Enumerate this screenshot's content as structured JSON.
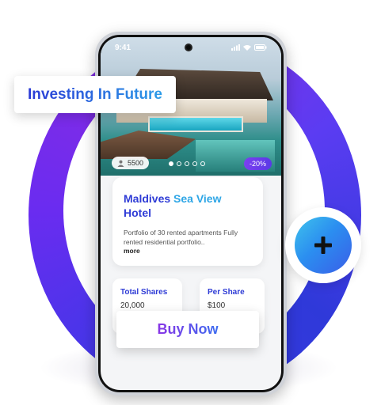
{
  "status_bar": {
    "time": "9:41"
  },
  "callouts": {
    "headline": "Investing In Future",
    "buy_now": "Buy Now"
  },
  "property": {
    "owners_count": "5500",
    "discount": "-20%",
    "title_part1": "Maldives",
    "title_part2": "Sea View",
    "title_part3": "Hotel",
    "description": "Portfolio of 30 rented apartments Fully rented residential portfolio..",
    "more_label": "more",
    "image_dots": 5,
    "active_dot": 0
  },
  "stats": {
    "total_shares_label": "Total Shares",
    "total_shares_value": "20,000",
    "per_share_label": "Per Share",
    "per_share_value": "$100"
  },
  "colors": {
    "ring": "#5b3cf2",
    "title": "#2f3cd6",
    "title_accent": "#2ea6e6",
    "badge": "#7b3ff0"
  }
}
